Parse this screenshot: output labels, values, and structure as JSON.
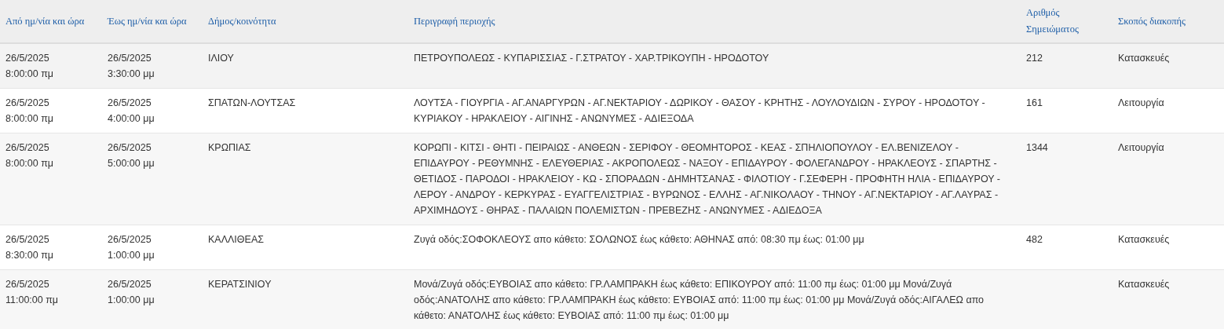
{
  "table": {
    "columns": [
      "Από ημ/νία και ώρα",
      "Έως ημ/νία και ώρα",
      "Δήμος/κοινότητα",
      "Περιγραφή περιοχής",
      "Αριθμός Σημειώματος",
      "Σκοπός διακοπής"
    ],
    "rows": [
      {
        "from": "26/5/2025 8:00:00 πμ",
        "to": "26/5/2025 3:30:00 μμ",
        "municipality": "ΙΛΙΟΥ",
        "area": "ΠΕΤΡΟΥΠΟΛΕΩΣ - ΚΥΠΑΡΙΣΣΙΑΣ - Γ.ΣΤΡΑΤΟΥ - ΧΑΡ.ΤΡΙΚΟΥΠΗ - ΗΡΟΔΟΤΟΥ",
        "note_number": "212",
        "purpose": "Κατασκευές"
      },
      {
        "from": "26/5/2025 8:00:00 πμ",
        "to": "26/5/2025 4:00:00 μμ",
        "municipality": "ΣΠΑΤΩΝ-ΛΟΥΤΣΑΣ",
        "area": "ΛΟΥΤΣΑ - ΓΙΟΥΡΓΙΑ - ΑΓ.ΑΝΑΡΓΥΡΩΝ - ΑΓ.ΝΕΚΤΑΡΙΟΥ - ΔΩΡΙΚΟΥ - ΘΑΣΟΥ - ΚΡΗΤΗΣ - ΛΟΥΛΟΥΔΙΩΝ - ΣΥΡΟΥ - ΗΡΟΔΟΤΟΥ - ΚΥΡΙΑΚΟΥ - ΗΡΑΚΛΕΙΟΥ - ΑΙΓΙΝΗΣ - ΑΝΩΝΥΜΕΣ - ΑΔΙΕΞΟΔΑ",
        "note_number": "161",
        "purpose": "Λειτουργία"
      },
      {
        "from": "26/5/2025 8:00:00 πμ",
        "to": "26/5/2025 5:00:00 μμ",
        "municipality": "ΚΡΩΠΙΑΣ",
        "area": "ΚΟΡΩΠΙ - ΚΙΤΣΙ - ΘΗΤΙ - ΠΕΙΡΑΙΩΣ - ΑΝΘΕΩΝ - ΣΕΡΙΦΟΥ - ΘΕΟΜΗΤΟΡΟΣ - ΚΕΑΣ - ΣΠΗΛΙΟΠΟΥΛΟΥ - ΕΛ.ΒΕΝΙΖΕΛΟΥ - ΕΠΙΔΑΥΡΟΥ - ΡΕΘΥΜΝΗΣ - ΕΛΕΥΘΕΡΙΑΣ - ΑΚΡΟΠΟΛΕΩΣ - ΝΑΞΟΥ - ΕΠΙΔΑΥΡΟΥ - ΦΟΛΕΓΑΝΔΡΟΥ - ΗΡΑΚΛΕΟΥΣ - ΣΠΑΡΤΗΣ - ΘΕΤΙΔΟΣ - ΠΑΡΟΔΟΙ - ΗΡΑΚΛΕΙΟΥ - ΚΩ - ΣΠΟΡΑΔΩΝ - ΔΗΜΗΤΣΑΝΑΣ - ΦΙΛΟΤΙΟΥ - Γ.ΣΕΦΕΡΗ - ΠΡΟΦΗΤΗ ΗΛΙΑ - ΕΠΙΔΑΥΡΟΥ - ΛΕΡΟΥ - ΑΝΔΡΟΥ - ΚΕΡΚΥΡΑΣ - ΕΥΑΓΓΕΛΙΣΤΡΙΑΣ - ΒΥΡΩΝΟΣ - ΕΛΛΗΣ - ΑΓ.ΝΙΚΟΛΑΟΥ - ΤΗΝΟΥ - ΑΓ.ΝΕΚΤΑΡΙΟΥ - ΑΓ.ΛΑΥΡΑΣ - ΑΡΧΙΜΗΔΟΥΣ - ΘΗΡΑΣ - ΠΑΛΑΙΩΝ ΠΟΛΕΜΙΣΤΩΝ - ΠΡΕΒΕΖΗΣ - ΑΝΩΝΥΜΕΣ - ΑΔΙΕΔΟΞΑ",
        "note_number": "1344",
        "purpose": "Λειτουργία"
      },
      {
        "from": "26/5/2025 8:30:00 πμ",
        "to": "26/5/2025 1:00:00 μμ",
        "municipality": "ΚΑΛΛΙΘΕΑΣ",
        "area": "Ζυγά οδός:ΣΟΦΟΚΛΕΟΥΣ απο κάθετο: ΣΟΛΩΝΟΣ έως κάθετο: ΑΘΗΝΑΣ από: 08:30 πμ έως: 01:00 μμ",
        "note_number": "482",
        "purpose": "Κατασκευές"
      },
      {
        "from": "26/5/2025 11:00:00 πμ",
        "to": "26/5/2025 1:00:00 μμ",
        "municipality": "ΚΕΡΑΤΣΙΝΙΟΥ",
        "area": "Μονά/Ζυγά οδός:ΕΥΒΟΙΑΣ απο κάθετο: ΓΡ.ΛΑΜΠΡΑΚΗ έως κάθετο: ΕΠΙΚΟΥΡΟΥ από: 11:00 πμ έως: 01:00 μμ Μονά/Ζυγά οδός:ΑΝΑΤΟΛΗΣ απο κάθετο: ΓΡ.ΛΑΜΠΡΑΚΗ έως κάθετο: ΕΥΒΟΙΑΣ από: 11:00 πμ έως: 01:00 μμ Μονά/Ζυγά οδός:ΑΙΓΑΛΕΩ απο κάθετο: ΑΝΑΤΟΛΗΣ έως κάθετο: ΕΥΒΟΙΑΣ από: 11:00 πμ έως: 01:00 μμ",
        "purpose": "Κατασκευές"
      }
    ]
  }
}
